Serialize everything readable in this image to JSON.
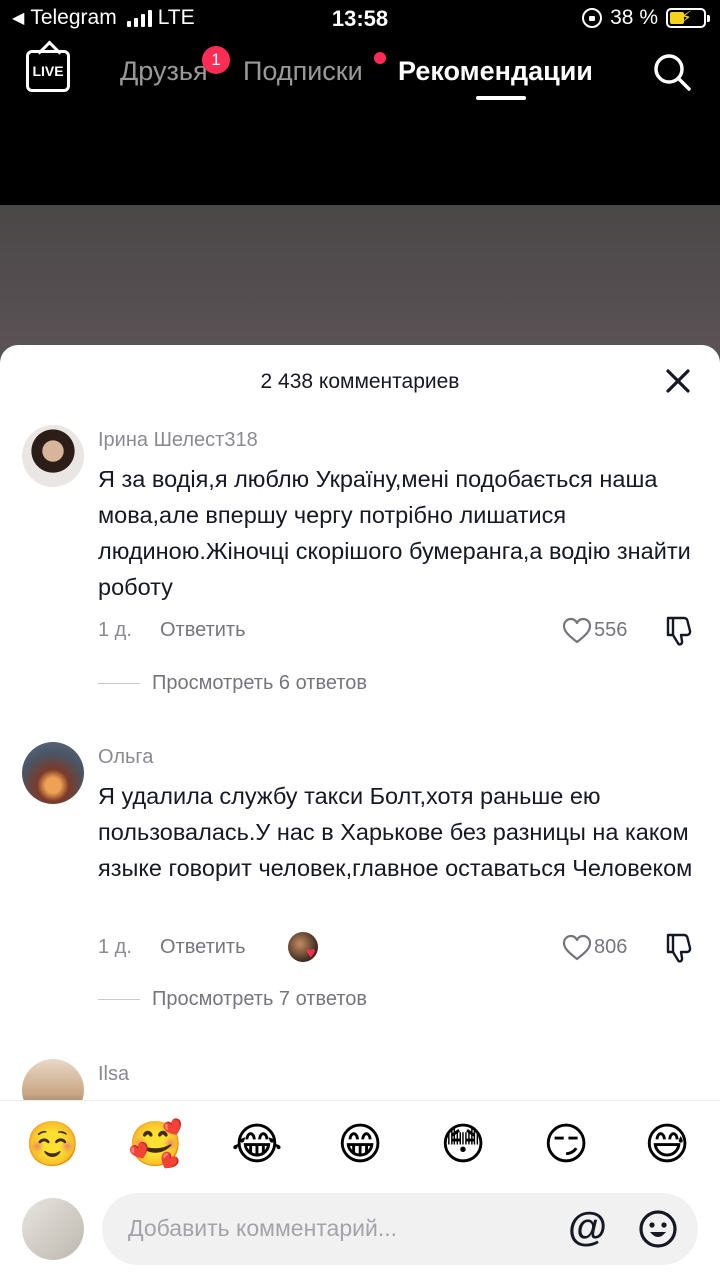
{
  "status_bar": {
    "back_app": "Telegram",
    "network": "LTE",
    "time": "13:58",
    "battery_percent": "38 %"
  },
  "top_nav": {
    "live_label": "LIVE",
    "tabs": [
      {
        "label": "Друзья",
        "badge": "1"
      },
      {
        "label": "Подписки"
      },
      {
        "label": "Рекомендации",
        "active": true
      }
    ]
  },
  "comments_sheet": {
    "title": "2 438 комментариев",
    "comments": [
      {
        "author": "Ірина Шелест318",
        "text": "Я за водія,я люблю Україну,мені подобається наша мова,але впершу чергу потрібно лишатися людиною.Жіночці скорішого бумеранга,а водію знайти роботу",
        "time": "1 д.",
        "reply_label": "Ответить",
        "likes": "556",
        "view_replies": "Просмотреть 6 ответов"
      },
      {
        "author": "Ольга",
        "text": "Я удалила службу такси Болт,хотя раньше ею пользовалась.У нас в Харькове без разницы на каком языке говорит человек,главное оставаться Человеком",
        "time": "1 д.",
        "reply_label": "Ответить",
        "likes": "806",
        "view_replies": "Просмотреть 7 ответов"
      },
      {
        "author": "Ilsa"
      }
    ]
  },
  "emoji_bar": [
    "☺️",
    "🥰",
    "😂",
    "😁",
    "😳",
    "😏",
    "😅"
  ],
  "input": {
    "placeholder": "Добавить комментарий...",
    "at_symbol": "@"
  },
  "colors": {
    "accent_red": "#ff2d55",
    "text_primary": "#161823",
    "text_secondary": "#8a8b91"
  }
}
